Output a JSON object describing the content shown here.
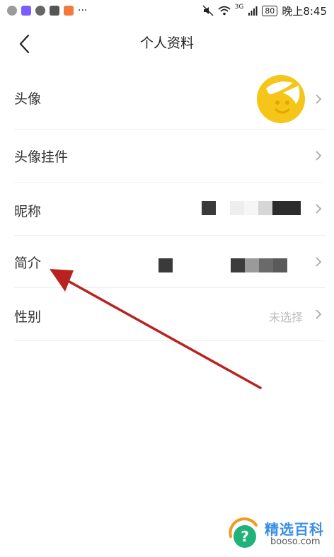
{
  "status_bar": {
    "time": "晚上8:45",
    "battery": "80",
    "network": "3G",
    "more": "···"
  },
  "header": {
    "title": "个人资料"
  },
  "rows": [
    {
      "label": "头像"
    },
    {
      "label": "头像挂件"
    },
    {
      "label": "昵称"
    },
    {
      "label": "简介"
    },
    {
      "label": "性别",
      "value": "未选择"
    }
  ],
  "watermark": {
    "title": "精选百科",
    "domain": "booso.com",
    "icon_glyph": "?"
  },
  "colors": {
    "arrow": "#b8231f",
    "avatar": "#f5c518",
    "wm_blue": "#3a8ee8",
    "wm_orange": "#f29b1e",
    "wm_green": "#1fb37a"
  }
}
